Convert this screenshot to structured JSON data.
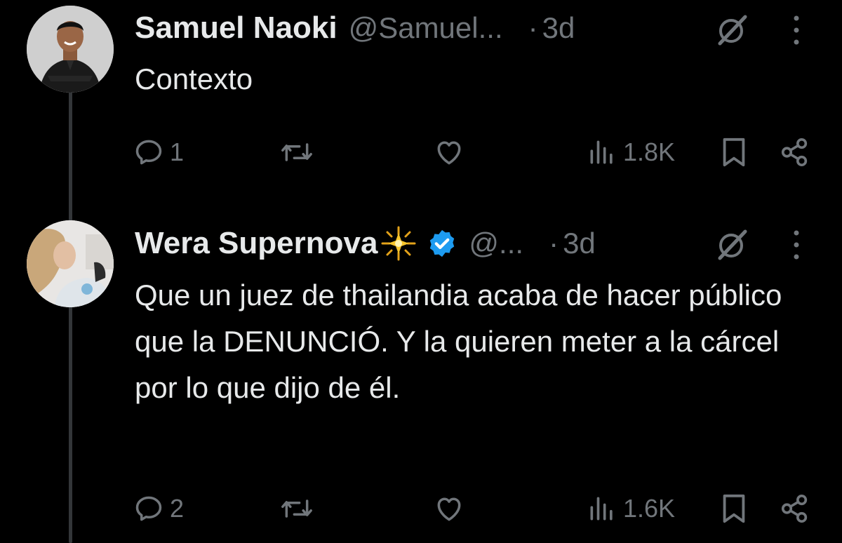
{
  "tweets": [
    {
      "author_name": "Samuel Naoki",
      "author_emoji": "",
      "handle": "@Samuel...",
      "separator": "·",
      "time": "3d",
      "text": "Contexto",
      "replies": "1",
      "retweets": "",
      "likes": "",
      "views": "1.8K",
      "verified": false
    },
    {
      "author_name": "Wera Supernova",
      "author_emoji": "🌟",
      "handle": "@...",
      "separator": "·",
      "time": "3d",
      "text": "Que un juez de thailandia acaba de hacer público que la DENUNCIÓ. Y la quieren meter a la cárcel por lo que dijo de él.",
      "replies": "2",
      "retweets": "",
      "likes": "",
      "views": "1.6K",
      "verified": true
    }
  ],
  "colors": {
    "background": "#000000",
    "primary_text": "#e7e9ea",
    "secondary_text": "#71767b",
    "verified_badge": "#1d9bf0",
    "thread_line": "#333639"
  },
  "icons": [
    "avatar",
    "grok-icon",
    "more-icon",
    "reply-icon",
    "retweet-icon",
    "like-icon",
    "views-icon",
    "bookmark-icon",
    "share-icon",
    "verified-badge-icon",
    "sparkle-emoji-icon"
  ]
}
